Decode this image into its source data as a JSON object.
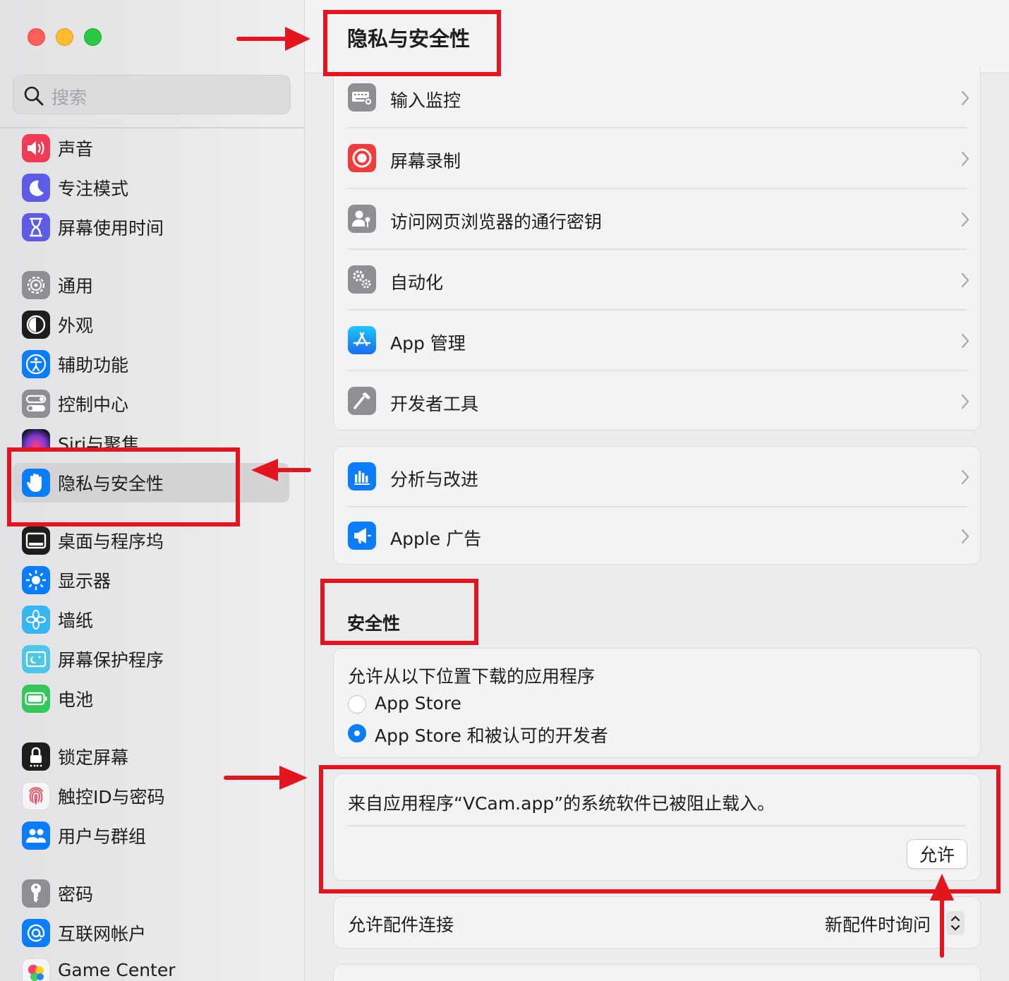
{
  "sidebar": {
    "search_placeholder": "搜索",
    "items": [
      {
        "label": "声音",
        "icon": "speaker-icon",
        "color": "#f23c55"
      },
      {
        "label": "专注模式",
        "icon": "moon-icon",
        "color": "#5e5ce6"
      },
      {
        "label": "屏幕使用时间",
        "icon": "hourglass-icon",
        "color": "#5e5ce6"
      },
      {
        "label": "通用",
        "icon": "gear-icon",
        "color": "#8e8e93"
      },
      {
        "label": "外观",
        "icon": "appearance-icon",
        "color": "#1d1d1f"
      },
      {
        "label": "辅助功能",
        "icon": "accessibility-icon",
        "color": "#0a7dff"
      },
      {
        "label": "控制中心",
        "icon": "switches-icon",
        "color": "#8e8e93"
      },
      {
        "label": "Siri与聚焦",
        "icon": "siri-icon",
        "color": "#2b2b45"
      },
      {
        "label": "隐私与安全性",
        "icon": "hand-icon",
        "color": "#0a7dff"
      },
      {
        "label": "桌面与程序坞",
        "icon": "dock-icon",
        "color": "#1d1d1f"
      },
      {
        "label": "显示器",
        "icon": "sun-icon",
        "color": "#0a7dff"
      },
      {
        "label": "墙纸",
        "icon": "flower-icon",
        "color": "#36b6f5"
      },
      {
        "label": "屏幕保护程序",
        "icon": "screensaver-icon",
        "color": "#4ec6e8"
      },
      {
        "label": "电池",
        "icon": "battery-icon",
        "color": "#34c759"
      },
      {
        "label": "锁定屏幕",
        "icon": "lock-icon",
        "color": "#1d1d1f"
      },
      {
        "label": "触控ID与密码",
        "icon": "fingerprint-icon",
        "color": "#f5f5f7"
      },
      {
        "label": "用户与群组",
        "icon": "users-icon",
        "color": "#0a7dff"
      },
      {
        "label": "密码",
        "icon": "key-icon",
        "color": "#8e8e93"
      },
      {
        "label": "互联网帐户",
        "icon": "at-icon",
        "color": "#0a7dff"
      },
      {
        "label": "Game Center",
        "icon": "game-center-icon",
        "color": "#f5f5f7"
      }
    ]
  },
  "main": {
    "title": "隐私与安全性",
    "privacy_rows": [
      {
        "label": "输入监控",
        "icon": "keyboard-icon"
      },
      {
        "label": "屏幕录制",
        "icon": "record-icon"
      },
      {
        "label": "访问网页浏览器的通行密钥",
        "icon": "passkey-icon"
      },
      {
        "label": "自动化",
        "icon": "gears-icon"
      },
      {
        "label": "App 管理",
        "icon": "app-store-icon"
      },
      {
        "label": "开发者工具",
        "icon": "hammer-icon"
      }
    ],
    "analytics_rows": [
      {
        "label": "分析与改进",
        "icon": "chart-icon"
      },
      {
        "label": "Apple 广告",
        "icon": "megaphone-icon"
      }
    ],
    "security": {
      "section_title": "安全性",
      "allow_label": "允许从以下位置下载的应用程序",
      "option_1": "App Store",
      "option_2": "App Store 和被认可的开发者",
      "selected": "App Store 和被认可的开发者",
      "blocked_message": "来自应用程序“VCam.app”的系统软件已被阻止载入。",
      "allow_button": "允许",
      "accessory_label": "允许配件连接",
      "accessory_value": "新配件时询问"
    }
  },
  "colors": {
    "accent": "#0a7dff",
    "annotation_red": "#e3161f"
  }
}
